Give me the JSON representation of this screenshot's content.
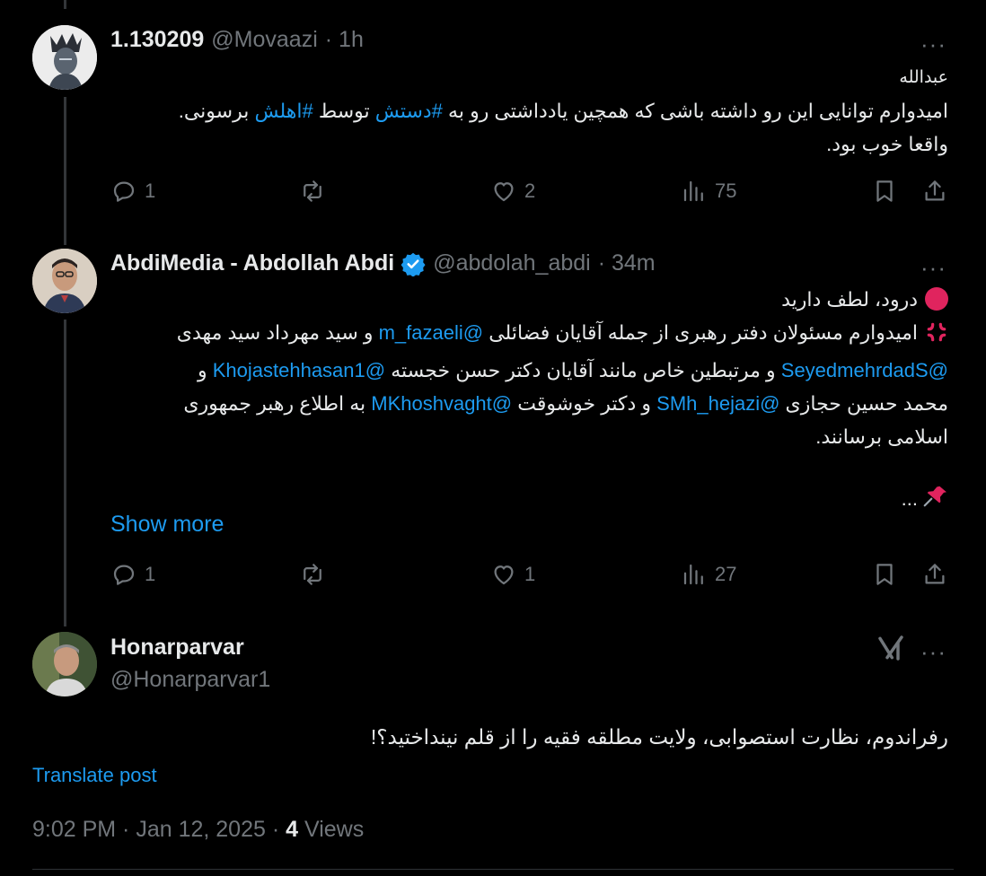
{
  "tweets": [
    {
      "name": "1.130209",
      "handle": "@Movaazi",
      "time": "· 1h",
      "body": {
        "line1": "عبدالله",
        "line2_pre": "امیدوارم توانایی این رو داشته باشی که همچین یادداشتی رو به ",
        "line2_tag1": "#دستش",
        "line2_mid": " توسط ",
        "line2_tag2": "#اهلش",
        "line2_post": " برسونی.",
        "line3": "واقعا خوب بود."
      },
      "replies": "1",
      "retweets": "",
      "likes": "2",
      "views": "75"
    },
    {
      "name": "AbdiMedia - Abdollah Abdi",
      "handle": "@abdolah_abdi",
      "time": "· 34m",
      "verified": true,
      "body": {
        "l1": "درود، لطف دارید",
        "l2_pre": "امیدوارم مسئولان دفتر رهبری از جمله آقایان فضائلی ",
        "l2_m1": "@m_fazaeli",
        "l2_post": " و سید مهرداد سید مهدی",
        "l3_m1": "@SeyedmehrdadS",
        "l3_mid": " و مرتبطین خاص مانند آقایان دکتر حسن خجسته ",
        "l3_m2": "@Khojastehhasan1",
        "l3_post": " و",
        "l4_pre": "محمد حسین حجازی ",
        "l4_m1": "@SMh_hejazi",
        "l4_mid": " و دکتر خوشوقت ",
        "l4_m2": "@MKhoshvaght",
        "l4_post": " به اطلاع رهبر جمهوری",
        "l5": "اسلامی برسانند.",
        "l6": "..."
      },
      "show_more": "Show more",
      "replies": "1",
      "retweets": "",
      "likes": "1",
      "views": "27"
    }
  ],
  "main": {
    "name": "Honarparvar",
    "handle": "@Honarparvar1",
    "body": "رفراندوم، نظارت استصوابی، ولایت مطلقه فقیه را از قلم نینداختید؟!",
    "translate": "Translate post",
    "time": "9:02 PM · Jan 12, 2025 ·",
    "views_count": "4",
    "views_label": "Views"
  },
  "icons": [
    "more-icon",
    "reply-icon",
    "retweet-icon",
    "like-icon",
    "views-icon",
    "bookmark-icon",
    "share-icon",
    "verified-icon",
    "grok-icon",
    "red-circle-icon",
    "anger-icon",
    "pushpin-icon"
  ],
  "colors": {
    "link": "#1d9bf0",
    "muted": "#71767b",
    "text": "#e7e9ea",
    "verified": "#1d9bf0"
  }
}
